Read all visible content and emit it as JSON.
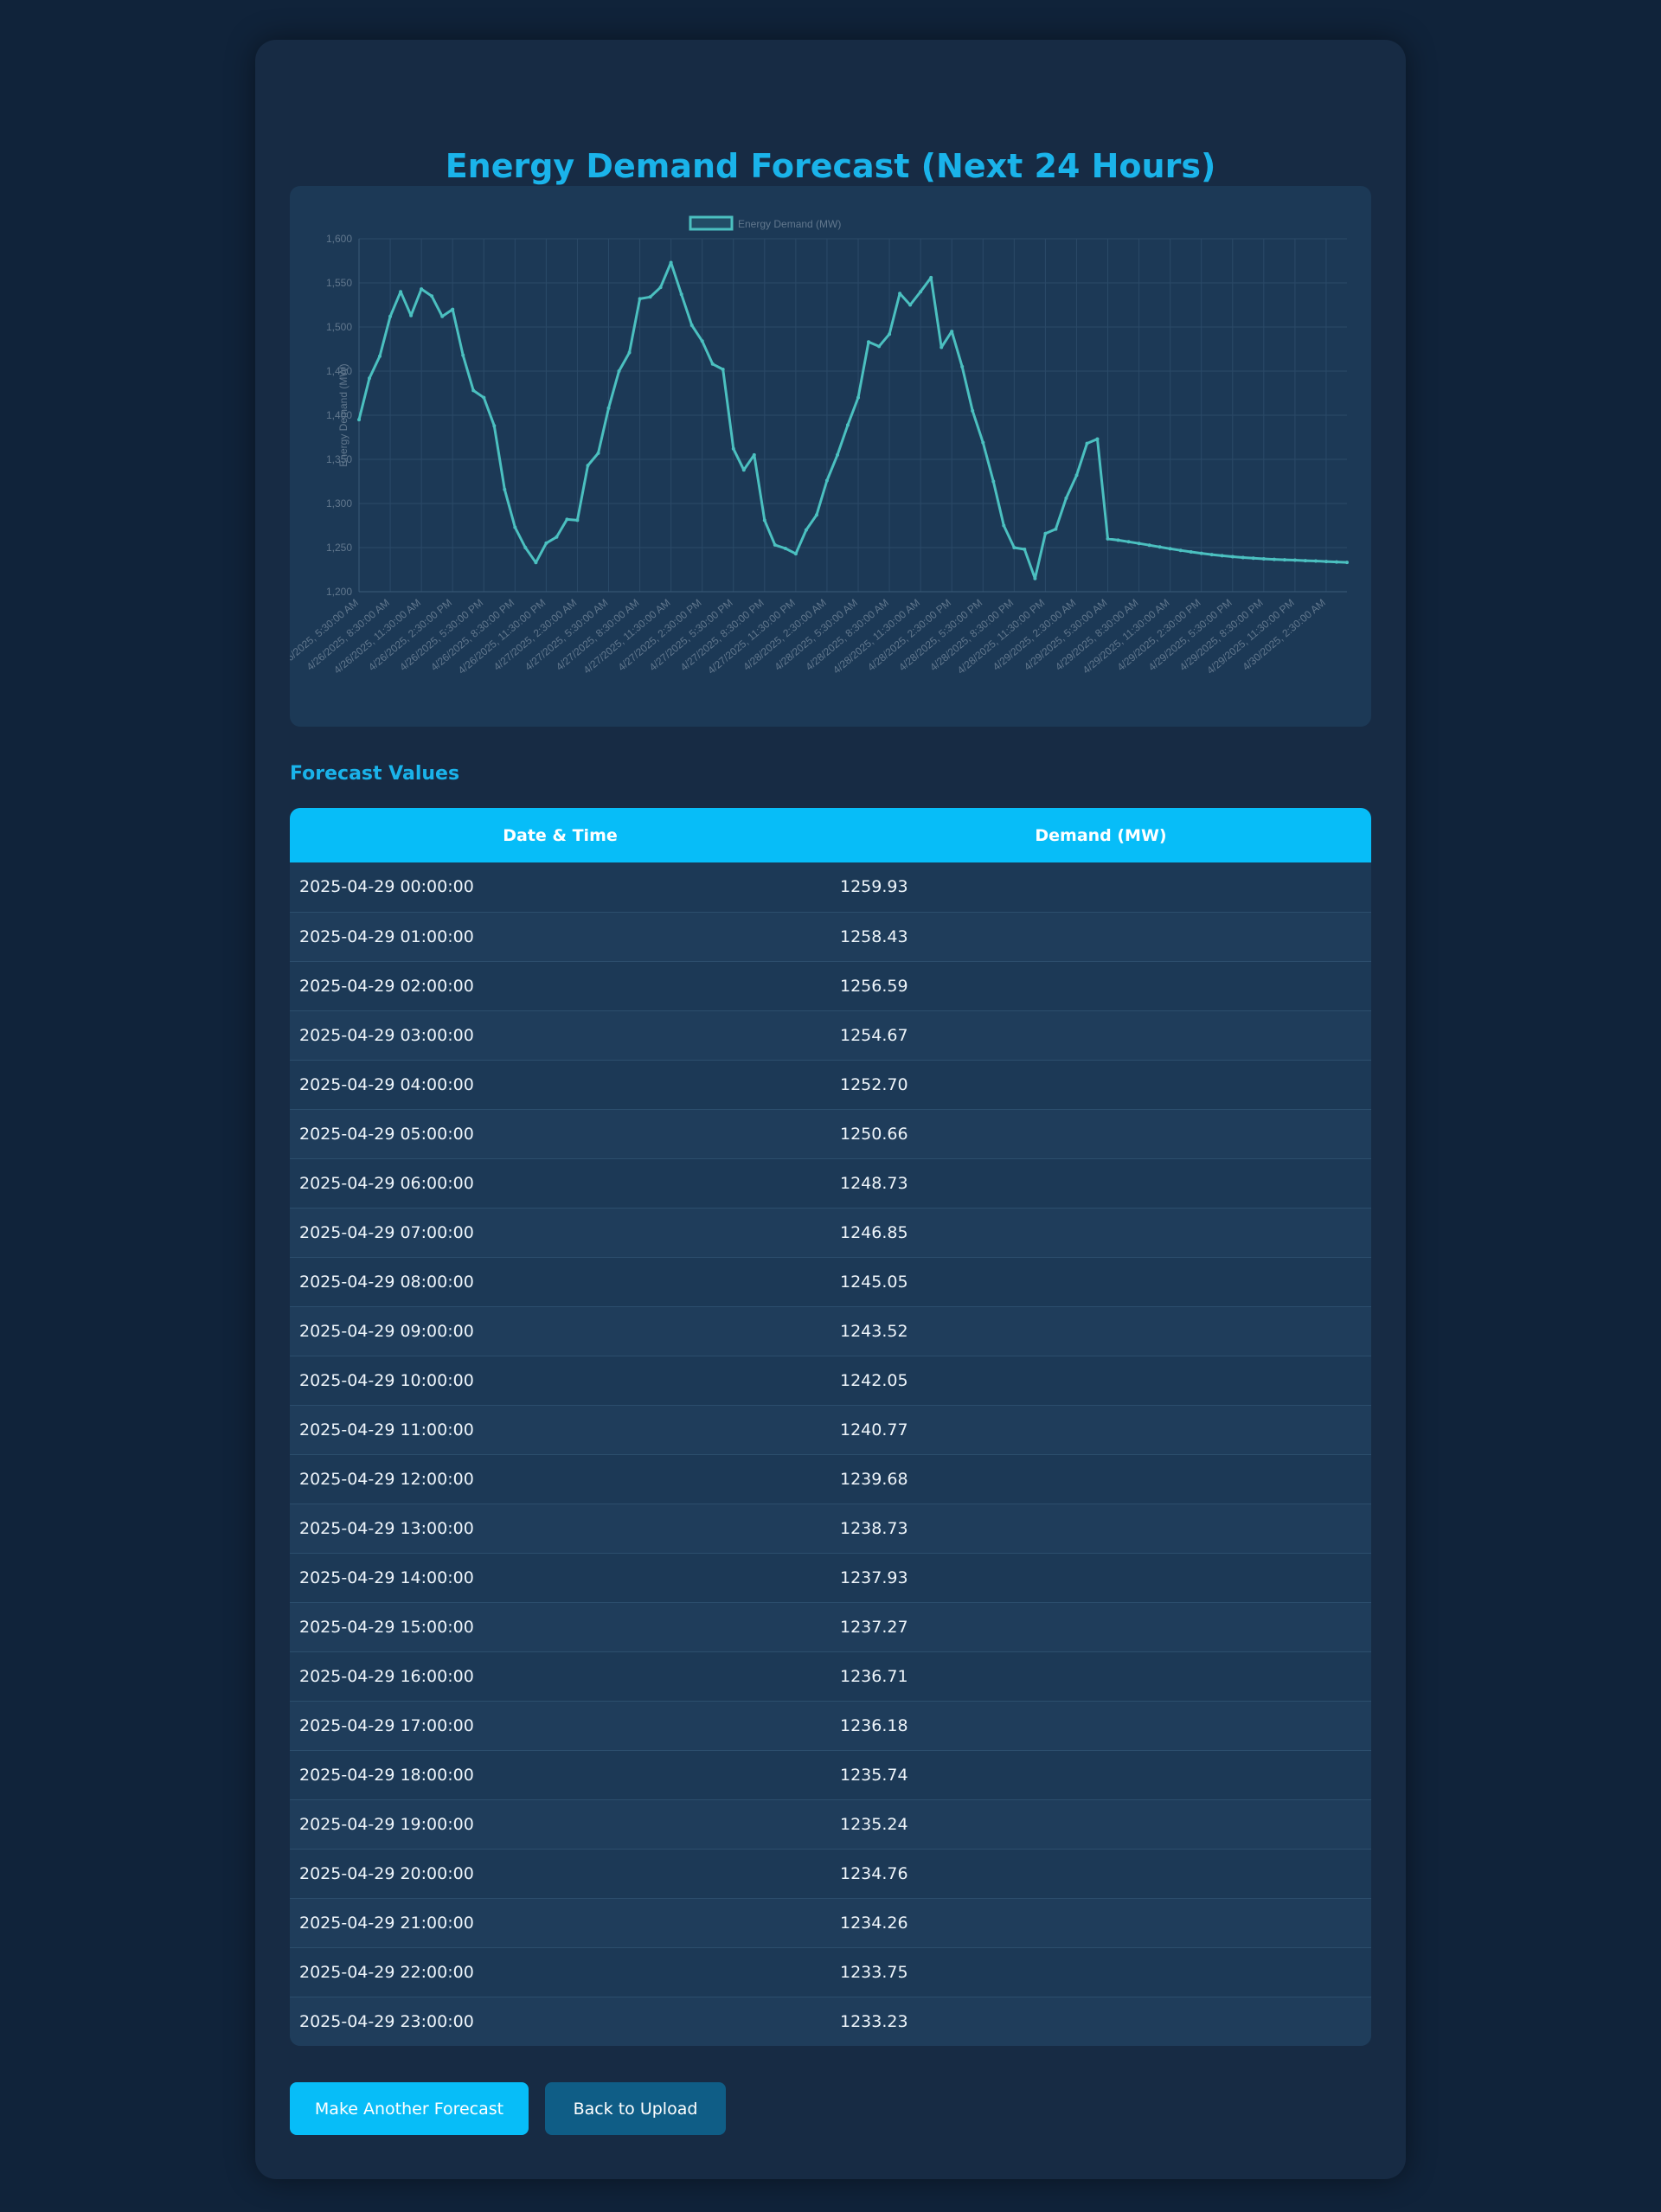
{
  "page": {
    "title": "Energy Demand Forecast (Next 24 Hours)",
    "section_title": "Forecast Values"
  },
  "colors": {
    "accent": "#1ab3ea",
    "header_bg": "#07bdf8",
    "line": "#4bc0c0",
    "background": "#10233a",
    "card": "#172b44"
  },
  "table": {
    "headers": [
      "Date & Time",
      "Demand (MW)"
    ],
    "rows": [
      [
        "2025-04-29 00:00:00",
        "1259.93"
      ],
      [
        "2025-04-29 01:00:00",
        "1258.43"
      ],
      [
        "2025-04-29 02:00:00",
        "1256.59"
      ],
      [
        "2025-04-29 03:00:00",
        "1254.67"
      ],
      [
        "2025-04-29 04:00:00",
        "1252.70"
      ],
      [
        "2025-04-29 05:00:00",
        "1250.66"
      ],
      [
        "2025-04-29 06:00:00",
        "1248.73"
      ],
      [
        "2025-04-29 07:00:00",
        "1246.85"
      ],
      [
        "2025-04-29 08:00:00",
        "1245.05"
      ],
      [
        "2025-04-29 09:00:00",
        "1243.52"
      ],
      [
        "2025-04-29 10:00:00",
        "1242.05"
      ],
      [
        "2025-04-29 11:00:00",
        "1240.77"
      ],
      [
        "2025-04-29 12:00:00",
        "1239.68"
      ],
      [
        "2025-04-29 13:00:00",
        "1238.73"
      ],
      [
        "2025-04-29 14:00:00",
        "1237.93"
      ],
      [
        "2025-04-29 15:00:00",
        "1237.27"
      ],
      [
        "2025-04-29 16:00:00",
        "1236.71"
      ],
      [
        "2025-04-29 17:00:00",
        "1236.18"
      ],
      [
        "2025-04-29 18:00:00",
        "1235.74"
      ],
      [
        "2025-04-29 19:00:00",
        "1235.24"
      ],
      [
        "2025-04-29 20:00:00",
        "1234.76"
      ],
      [
        "2025-04-29 21:00:00",
        "1234.26"
      ],
      [
        "2025-04-29 22:00:00",
        "1233.75"
      ],
      [
        "2025-04-29 23:00:00",
        "1233.23"
      ]
    ]
  },
  "buttons": {
    "primary": "Make Another Forecast",
    "secondary": "Back to Upload"
  },
  "chart_data": {
    "type": "line",
    "title": "",
    "ylabel": "Energy Demand (MW)",
    "ylim": [
      1200,
      1600
    ],
    "yticks": [
      "1,600",
      "1,550",
      "1,500",
      "1,450",
      "1,400",
      "1,350",
      "1,300",
      "1,250",
      "1,200"
    ],
    "grid": true,
    "legend": "top-center",
    "x": [
      "4/26/2025, 5:30:00 AM",
      "4/26/2025, 6:30:00 AM",
      "4/26/2025, 7:30:00 AM",
      "4/26/2025, 8:30:00 AM",
      "4/26/2025, 9:30:00 AM",
      "4/26/2025, 10:30:00 AM",
      "4/26/2025, 11:30:00 AM",
      "4/26/2025, 12:30:00 PM",
      "4/26/2025, 1:30:00 PM",
      "4/26/2025, 2:30:00 PM",
      "4/26/2025, 3:30:00 PM",
      "4/26/2025, 4:30:00 PM",
      "4/26/2025, 5:30:00 PM",
      "4/26/2025, 6:30:00 PM",
      "4/26/2025, 7:30:00 PM",
      "4/26/2025, 8:30:00 PM",
      "4/26/2025, 9:30:00 PM",
      "4/26/2025, 10:30:00 PM",
      "4/26/2025, 11:30:00 PM",
      "4/27/2025, 12:30:00 AM",
      "4/27/2025, 1:30:00 AM",
      "4/27/2025, 2:30:00 AM",
      "4/27/2025, 3:30:00 AM",
      "4/27/2025, 4:30:00 AM",
      "4/27/2025, 5:30:00 AM",
      "4/27/2025, 6:30:00 AM",
      "4/27/2025, 7:30:00 AM",
      "4/27/2025, 8:30:00 AM",
      "4/27/2025, 9:30:00 AM",
      "4/27/2025, 10:30:00 AM",
      "4/27/2025, 11:30:00 AM",
      "4/27/2025, 12:30:00 PM",
      "4/27/2025, 1:30:00 PM",
      "4/27/2025, 2:30:00 PM",
      "4/27/2025, 3:30:00 PM",
      "4/27/2025, 4:30:00 PM",
      "4/27/2025, 5:30:00 PM",
      "4/27/2025, 6:30:00 PM",
      "4/27/2025, 7:30:00 PM",
      "4/27/2025, 8:30:00 PM",
      "4/27/2025, 9:30:00 PM",
      "4/27/2025, 10:30:00 PM",
      "4/27/2025, 11:30:00 PM",
      "4/28/2025, 12:30:00 AM",
      "4/28/2025, 1:30:00 AM",
      "4/28/2025, 2:30:00 AM",
      "4/28/2025, 3:30:00 AM",
      "4/28/2025, 4:30:00 AM",
      "4/28/2025, 5:30:00 AM",
      "4/28/2025, 6:30:00 AM",
      "4/28/2025, 7:30:00 AM",
      "4/28/2025, 8:30:00 AM",
      "4/28/2025, 9:30:00 AM",
      "4/28/2025, 10:30:00 AM",
      "4/28/2025, 11:30:00 AM",
      "4/28/2025, 12:30:00 PM",
      "4/28/2025, 1:30:00 PM",
      "4/28/2025, 2:30:00 PM",
      "4/28/2025, 3:30:00 PM",
      "4/28/2025, 4:30:00 PM",
      "4/28/2025, 5:30:00 PM",
      "4/28/2025, 6:30:00 PM",
      "4/28/2025, 7:30:00 PM",
      "4/28/2025, 8:30:00 PM",
      "4/28/2025, 9:30:00 PM",
      "4/28/2025, 10:30:00 PM",
      "4/28/2025, 11:30:00 PM",
      "4/29/2025, 12:30:00 AM",
      "4/29/2025, 1:30:00 AM",
      "4/29/2025, 2:30:00 AM",
      "4/29/2025, 3:30:00 AM",
      "4/29/2025, 4:30:00 AM",
      "4/29/2025, 5:30:00 AM",
      "4/29/2025, 6:30:00 AM",
      "4/29/2025, 7:30:00 AM",
      "4/29/2025, 8:30:00 AM",
      "4/29/2025, 9:30:00 AM",
      "4/29/2025, 10:30:00 AM",
      "4/29/2025, 11:30:00 AM",
      "4/29/2025, 12:30:00 PM",
      "4/29/2025, 1:30:00 PM",
      "4/29/2025, 2:30:00 PM",
      "4/29/2025, 3:30:00 PM",
      "4/29/2025, 4:30:00 PM",
      "4/29/2025, 5:30:00 PM",
      "4/29/2025, 6:30:00 PM",
      "4/29/2025, 7:30:00 PM",
      "4/29/2025, 8:30:00 PM",
      "4/29/2025, 9:30:00 PM",
      "4/29/2025, 10:30:00 PM",
      "4/29/2025, 11:30:00 PM",
      "4/30/2025, 12:30:00 AM",
      "4/30/2025, 1:30:00 AM",
      "4/30/2025, 2:30:00 AM",
      "4/30/2025, 3:30:00 AM",
      "4/30/2025, 4:30:00 AM"
    ],
    "x_tick_labels": [
      "4/26/2025, 5:30:00 AM",
      "4/26/2025, 8:30:00 AM",
      "4/26/2025, 11:30:00 AM",
      "4/26/2025, 2:30:00 PM",
      "4/26/2025, 5:30:00 PM",
      "4/26/2025, 8:30:00 PM",
      "4/26/2025, 11:30:00 PM",
      "4/27/2025, 2:30:00 AM",
      "4/27/2025, 5:30:00 AM",
      "4/27/2025, 8:30:00 AM",
      "4/27/2025, 11:30:00 AM",
      "4/27/2025, 2:30:00 PM",
      "4/27/2025, 5:30:00 PM",
      "4/27/2025, 8:30:00 PM",
      "4/27/2025, 11:30:00 PM",
      "4/28/2025, 2:30:00 AM",
      "4/28/2025, 5:30:00 AM",
      "4/28/2025, 8:30:00 AM",
      "4/28/2025, 11:30:00 AM",
      "4/28/2025, 2:30:00 PM",
      "4/28/2025, 5:30:00 PM",
      "4/28/2025, 8:30:00 PM",
      "4/28/2025, 11:30:00 PM",
      "4/29/2025, 2:30:00 AM",
      "4/29/2025, 5:30:00 AM",
      "4/29/2025, 8:30:00 AM",
      "4/29/2025, 11:30:00 AM",
      "4/29/2025, 2:30:00 PM",
      "4/29/2025, 5:30:00 PM",
      "4/29/2025, 8:30:00 PM",
      "4/29/2025, 11:30:00 PM",
      "4/30/2025, 2:30:00 AM"
    ],
    "series": [
      {
        "name": "Energy Demand (MW)",
        "color": "#4bc0c0",
        "values": [
          1395,
          1442,
          1467,
          1512,
          1540,
          1513,
          1543,
          1535,
          1512,
          1520,
          1468,
          1428,
          1420,
          1388,
          1316,
          1273,
          1250,
          1233,
          1255,
          1262,
          1282,
          1281,
          1343,
          1357,
          1408,
          1450,
          1471,
          1532,
          1534,
          1545,
          1573,
          1537,
          1502,
          1484,
          1458,
          1452,
          1362,
          1338,
          1355,
          1281,
          1253,
          1249,
          1243,
          1270,
          1287,
          1326,
          1355,
          1389,
          1420,
          1483,
          1478,
          1492,
          1538,
          1525,
          1540,
          1556,
          1477,
          1495,
          1455,
          1405,
          1369,
          1325,
          1275,
          1250,
          1248,
          1215,
          1266,
          1271,
          1306,
          1332,
          1368,
          1373,
          1259.93,
          1258.43,
          1256.59,
          1254.67,
          1252.7,
          1250.66,
          1248.73,
          1246.85,
          1245.05,
          1243.52,
          1242.05,
          1240.77,
          1239.68,
          1238.73,
          1237.93,
          1237.27,
          1236.71,
          1236.18,
          1235.74,
          1235.24,
          1234.76,
          1234.26,
          1233.75,
          1233.23
        ]
      }
    ]
  }
}
